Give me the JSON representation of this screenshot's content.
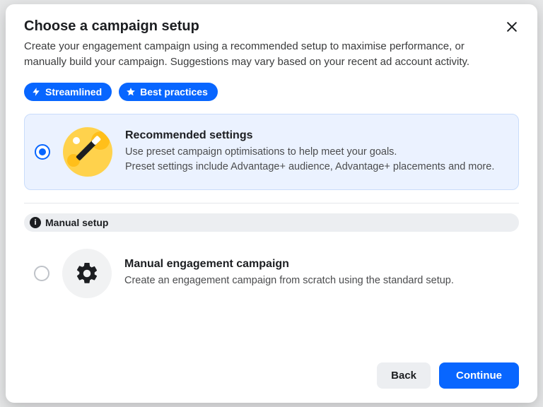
{
  "header": {
    "title": "Choose a campaign setup",
    "subtitle": "Create your engagement campaign using a recommended setup to maximise performance, or manually build your campaign. Suggestions may vary based on your recent ad account activity."
  },
  "badges": {
    "streamlined": "Streamlined",
    "best_practices": "Best practices"
  },
  "options": {
    "recommended": {
      "title": "Recommended settings",
      "line1": "Use preset campaign optimisations to help meet your goals.",
      "line2": "Preset settings include Advantage+ audience, Advantage+ placements and more."
    },
    "manual_badge": "Manual setup",
    "manual": {
      "title": "Manual engagement campaign",
      "desc": "Create an engagement campaign from scratch using the standard setup."
    }
  },
  "footer": {
    "back": "Back",
    "continue": "Continue"
  }
}
